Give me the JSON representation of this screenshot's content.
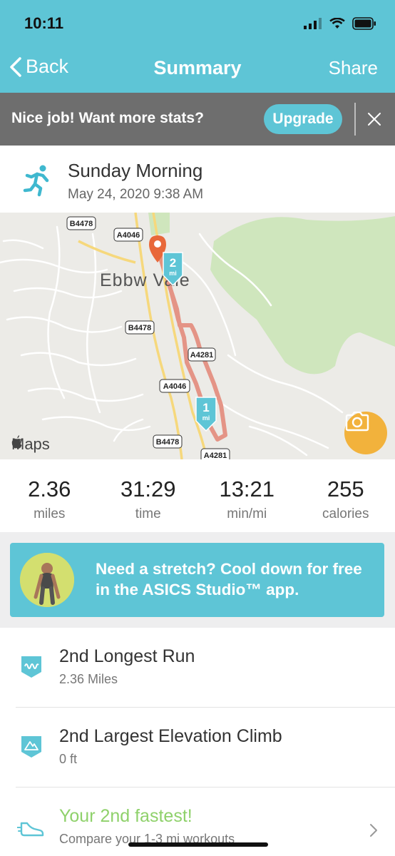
{
  "status_bar": {
    "time": "10:11"
  },
  "nav": {
    "back_label": "Back",
    "title": "Summary",
    "share_label": "Share"
  },
  "banner": {
    "message": "Nice job! Want more stats?",
    "upgrade_label": "Upgrade"
  },
  "activity": {
    "title": "Sunday Morning",
    "date": "May 24, 2020 9:38 AM"
  },
  "map": {
    "attribution": "Maps",
    "town_label": "Ebbw Vale",
    "road_labels": [
      "B4478",
      "A4046",
      "B4478",
      "A4281",
      "A4046",
      "B4478",
      "A4281"
    ],
    "mile_markers": [
      {
        "number": "2",
        "unit": "mi"
      },
      {
        "number": "1",
        "unit": "mi"
      }
    ],
    "route_color": "#e38b7b",
    "start_pin_color": "#e8683a"
  },
  "stats": [
    {
      "value": "2.36",
      "label": "miles"
    },
    {
      "value": "31:29",
      "label": "time"
    },
    {
      "value": "13:21",
      "label": "min/mi"
    },
    {
      "value": "255",
      "label": "calories"
    }
  ],
  "promo": {
    "text": "Need a stretch? Cool down for free in the ASICS Studio™ app."
  },
  "achievements": [
    {
      "title": "2nd Longest Run",
      "subtitle": "2.36 Miles",
      "icon": "distance-badge-icon"
    },
    {
      "title": "2nd Largest Elevation Climb",
      "subtitle": "0 ft",
      "icon": "elevation-badge-icon"
    },
    {
      "title": "Your 2nd fastest!",
      "subtitle": "Compare your 1-3 mi workouts",
      "icon": "shoe-icon"
    }
  ],
  "colors": {
    "accent": "#5ec5d6",
    "banner_bg": "#6e6e6e",
    "success_green": "#8fd16b",
    "camera_button": "#f2b23c"
  }
}
